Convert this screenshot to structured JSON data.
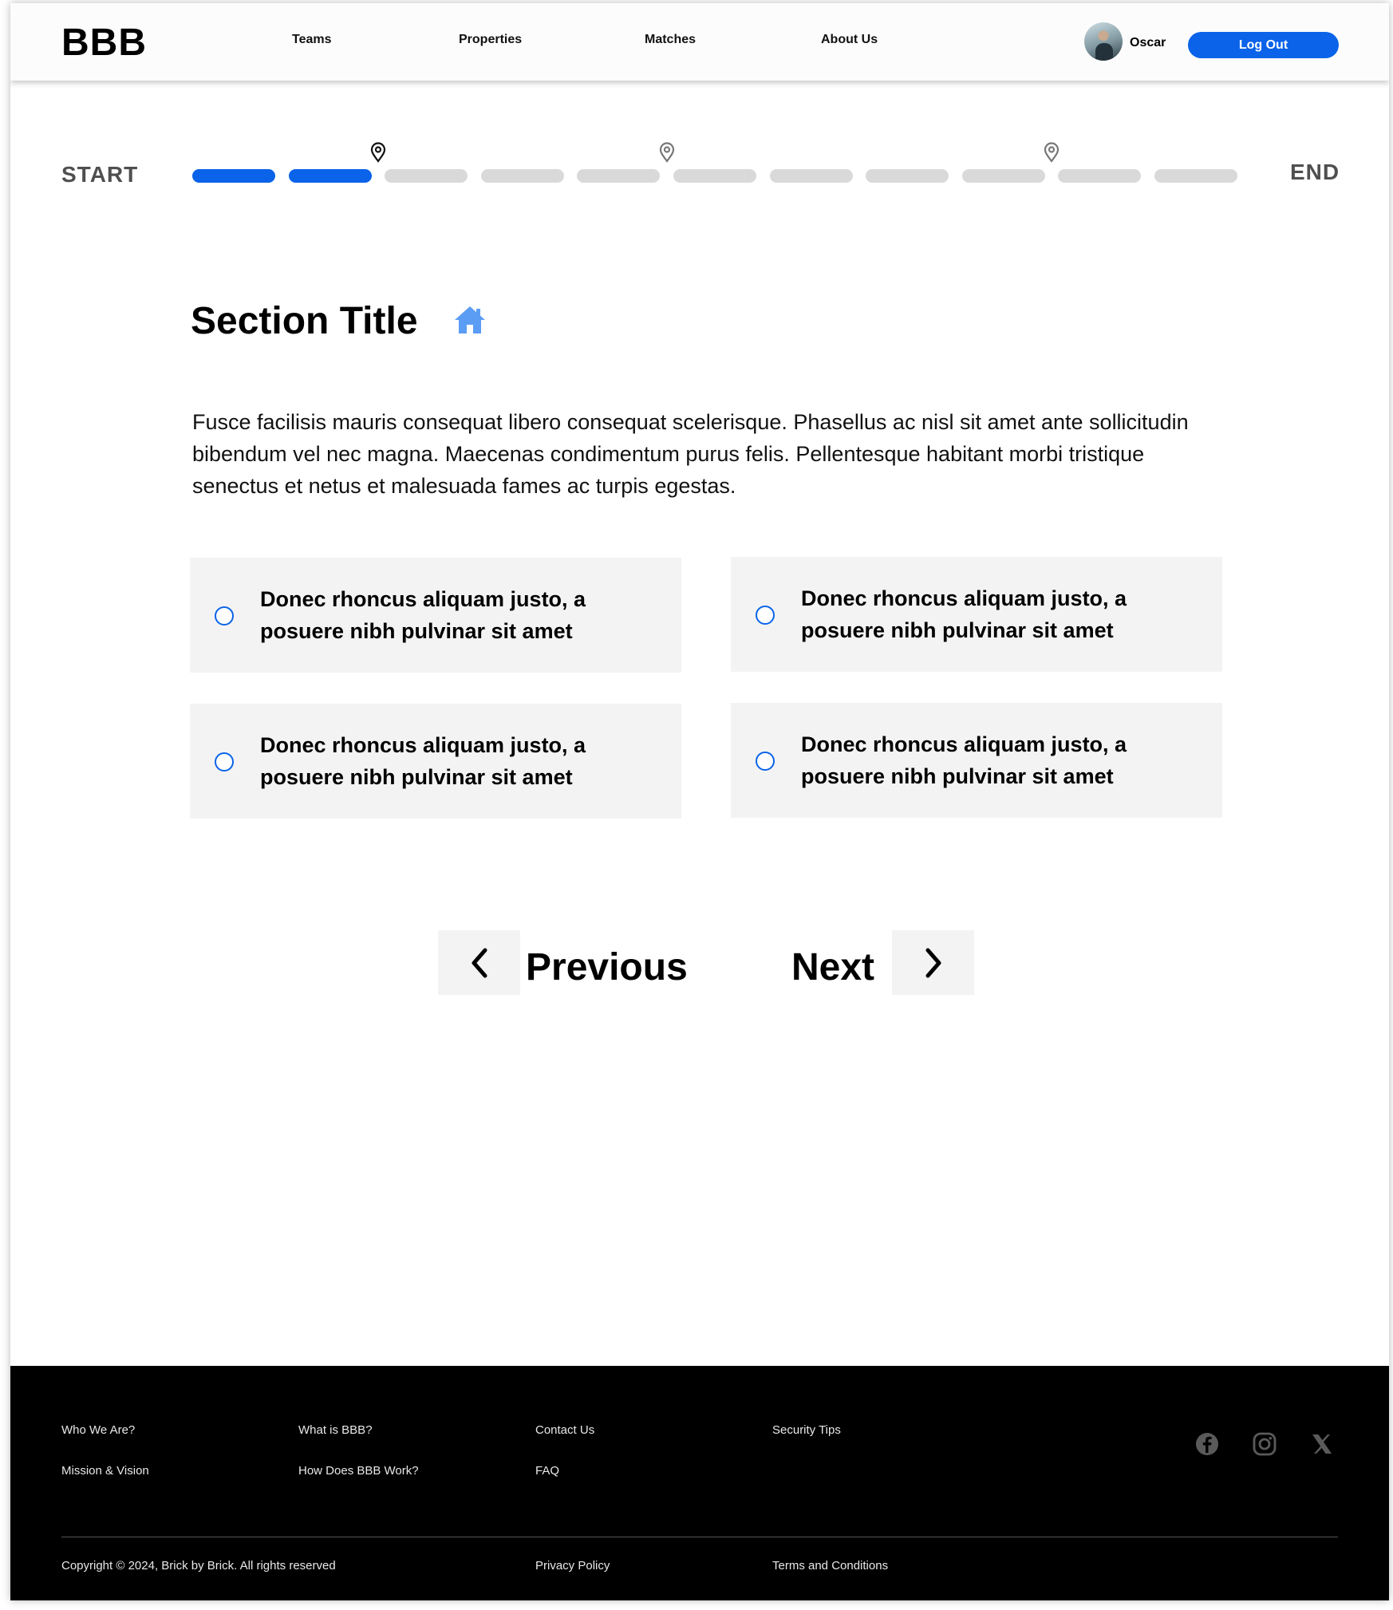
{
  "header": {
    "logo": "BBB",
    "nav": [
      "Teams",
      "Properties",
      "Matches",
      "About Us"
    ],
    "user_name": "Oscar",
    "logout_label": "Log Out"
  },
  "progress": {
    "start_label": "START",
    "end_label": "END",
    "total_steps": 11,
    "completed_steps": 2,
    "milestone_after_steps": [
      2,
      5,
      9
    ]
  },
  "section": {
    "title": "Section Title",
    "title_icon": "home-icon",
    "paragraph": "Fusce facilisis mauris consequat libero consequat scelerisque. Phasellus ac nisl sit amet ante sollicitudin bibendum vel nec magna. Maecenas condimentum purus felis. Pellentesque habitant morbi tristique senectus et netus et malesuada fames ac turpis egestas.",
    "options": [
      "Donec rhoncus aliquam justo, a posuere nibh pulvinar sit amet",
      "Donec rhoncus aliquam justo, a posuere nibh pulvinar sit amet",
      "Donec rhoncus aliquam justo, a posuere nibh pulvinar sit amet",
      "Donec rhoncus aliquam justo, a posuere nibh pulvinar sit amet"
    ]
  },
  "pagination": {
    "previous_label": "Previous",
    "next_label": "Next"
  },
  "footer": {
    "links_row1": [
      "Who We Are?",
      "What is BBB?",
      "Contact Us",
      "Security Tips"
    ],
    "links_row2": [
      "Mission & Vision",
      "How Does BBB Work?",
      "FAQ"
    ],
    "copyright": "Copyright © 2024, Brick by Brick. All rights reserved",
    "privacy": "Privacy Policy",
    "terms": "Terms and Conditions",
    "social": [
      "facebook-icon",
      "instagram-icon",
      "x-icon"
    ]
  },
  "colors": {
    "accent": "#0a63e8",
    "step_inactive": "#d9d9d9",
    "option_bg": "#f3f3f3",
    "footer_bg": "#000000",
    "home_icon": "#5b9df5"
  }
}
